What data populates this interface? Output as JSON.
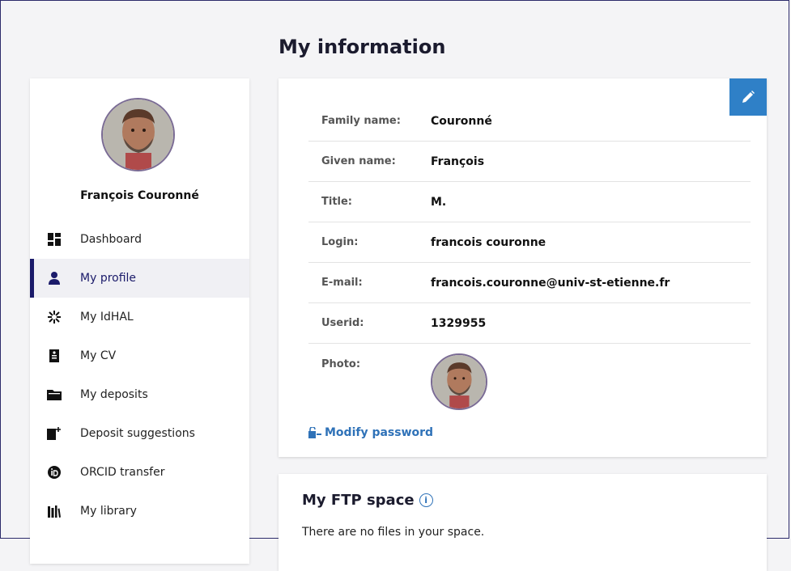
{
  "page": {
    "title": "My information"
  },
  "sidebar": {
    "user_name": "François Couronné",
    "items": [
      {
        "label": "Dashboard",
        "icon": "dashboard-icon"
      },
      {
        "label": "My profile",
        "icon": "person-icon",
        "active": true
      },
      {
        "label": "My IdHAL",
        "icon": "idhal-icon"
      },
      {
        "label": "My CV",
        "icon": "cv-icon"
      },
      {
        "label": "My deposits",
        "icon": "folder-icon"
      },
      {
        "label": "Deposit suggestions",
        "icon": "deposit-suggestion-icon"
      },
      {
        "label": "ORCID transfer",
        "icon": "orcid-icon"
      },
      {
        "label": "My library",
        "icon": "library-icon"
      }
    ]
  },
  "profile": {
    "rows": [
      {
        "label": "Family name:",
        "value": "Couronné"
      },
      {
        "label": "Given name:",
        "value": "François"
      },
      {
        "label": "Title:",
        "value": "M."
      },
      {
        "label": "Login:",
        "value": "francois couronne"
      },
      {
        "label": "E-mail:",
        "value": "francois.couronne@univ-st-etienne.fr"
      },
      {
        "label": "Userid:",
        "value": "1329955"
      }
    ],
    "photo_label": "Photo:",
    "modify_password": "Modify password"
  },
  "ftp": {
    "title": "My FTP space",
    "info_glyph": "i",
    "empty_text": "There are no files in your space."
  },
  "colors": {
    "accent": "#2f80c7",
    "nav_active": "#1b1b6a"
  }
}
